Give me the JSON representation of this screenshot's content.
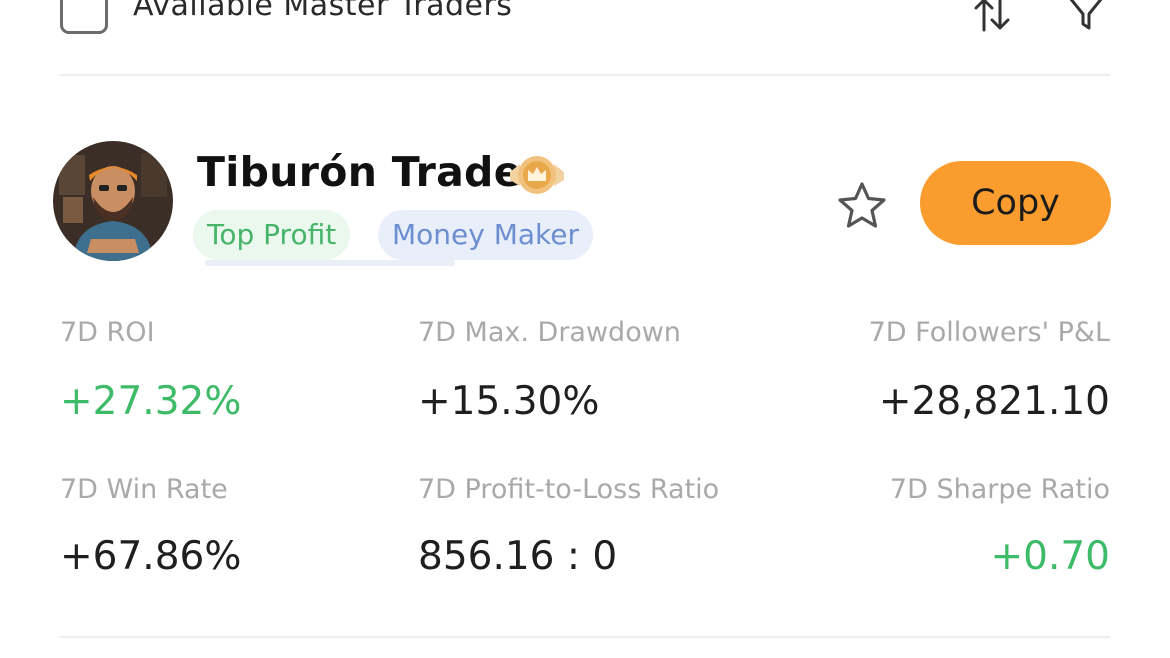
{
  "filter": {
    "checkbox_label": "Available Master Traders",
    "sort_icon": "sort-arrows-icon",
    "filter_icon": "funnel-icon"
  },
  "trader": {
    "name": "Tiburón Trade",
    "avatar_icon": "avatar",
    "badge_icon": "crown-badge-icon",
    "tags": [
      "Top Profit",
      "Money Maker"
    ],
    "favorite_icon": "star-icon",
    "copy_label": "Copy"
  },
  "metrics": [
    {
      "label": "7D ROI",
      "value": "+27.32%"
    },
    {
      "label": "7D Max. Drawdown",
      "value": "+15.30%"
    },
    {
      "label": "7D Followers' P&L",
      "value": "+28,821.10"
    },
    {
      "label": "7D Win Rate",
      "value": "+67.86%"
    },
    {
      "label": "7D Profit-to-Loss Ratio",
      "value": "856.16 : 0"
    },
    {
      "label": "7D Sharpe Ratio",
      "value": "+0.70"
    }
  ],
  "colors": {
    "accent_orange": "#fb9c2e",
    "positive_green": "#3dbb68",
    "tag_green_text": "#47b46a",
    "tag_blue_text": "#6d8fd0",
    "muted_label": "#a9a9a9"
  }
}
